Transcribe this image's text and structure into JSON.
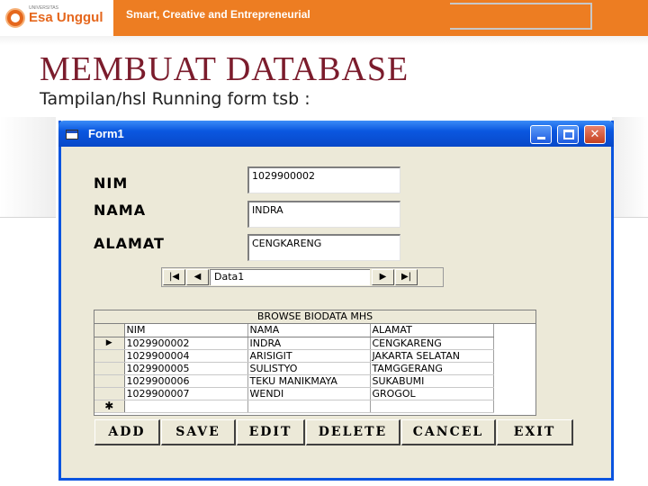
{
  "banner": {
    "logo_small": "UNIVERSITAS",
    "logo_text": "Esa Unggul",
    "tagline": "Smart, Creative and Entrepreneurial"
  },
  "slide": {
    "title": "MEMBUAT  DATABASE",
    "subtitle": "Tampilan/hsl Running form tsb :"
  },
  "window": {
    "title": "Form1",
    "icon": "form-window-icon"
  },
  "form": {
    "nim_label": "NIM",
    "nim_value": "1029900002",
    "nama_label": "NAMA",
    "nama_value": "INDRA",
    "alamat_label": "ALAMAT",
    "alamat_value": "CENGKARENG"
  },
  "data_control": {
    "caption": "Data1",
    "first": "|◀",
    "prev": "◀",
    "next": "▶",
    "last": "▶|"
  },
  "grid": {
    "caption": "BROWSE BIODATA MHS",
    "columns": [
      "NIM",
      "NAMA",
      "ALAMAT"
    ],
    "current_row_marker": "▶",
    "new_row_marker": "✱",
    "rows": [
      {
        "nim": "1029900002",
        "nama": "INDRA",
        "alamat": "CENGKARENG"
      },
      {
        "nim": "1029900004",
        "nama": "ARISIGIT",
        "alamat": "JAKARTA SELATAN"
      },
      {
        "nim": "1029900005",
        "nama": "SULISTYO",
        "alamat": "TAMGGERANG"
      },
      {
        "nim": "1029900006",
        "nama": "TEKU MANIKMAYA",
        "alamat": "SUKABUMI"
      },
      {
        "nim": "1029900007",
        "nama": "WENDI",
        "alamat": "GROGOL"
      }
    ]
  },
  "buttons": {
    "add": "ADD",
    "save": "SAVE",
    "edit": "EDIT",
    "delete": "DELETE",
    "cancel": "CANCEL",
    "exit": "EXIT"
  },
  "colors": {
    "banner": "#ed7d22",
    "title": "#7b1c2c",
    "titlebar": "#0a57e0",
    "window_face": "#ece9d8"
  }
}
